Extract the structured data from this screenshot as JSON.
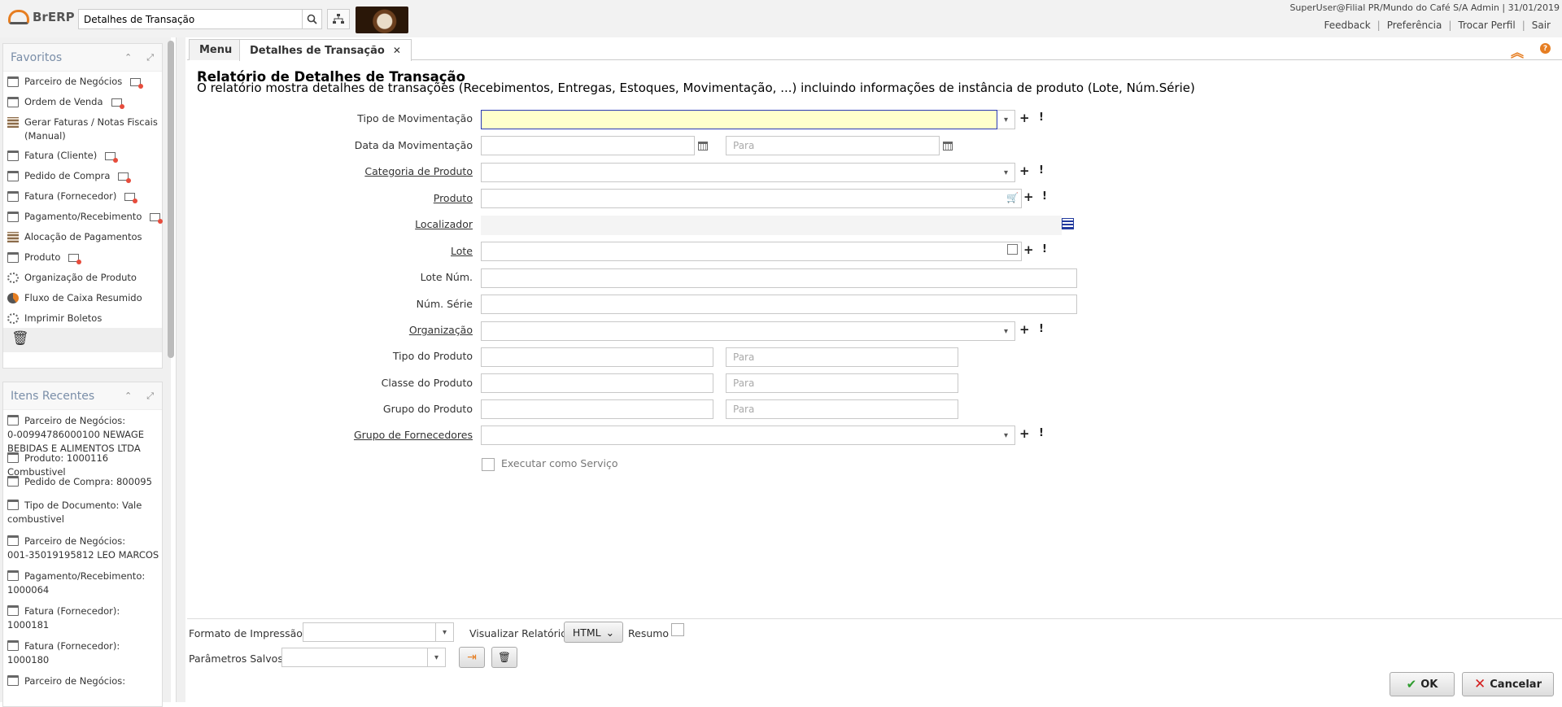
{
  "header": {
    "logo_text": "BrERP",
    "search_value": "Detalhes de Transação",
    "user_info": "SuperUser@Filial PR/Mundo do Café S/A Admin | 31/01/2019",
    "links": [
      "Feedback",
      "Preferência",
      "Trocar Perfil",
      "Sair"
    ]
  },
  "favorites": {
    "title": "Favoritos",
    "items": [
      {
        "label": "Parceiro de Negócios",
        "icon": "window-icon",
        "newwin": true
      },
      {
        "label": "Ordem de Venda",
        "icon": "window-icon",
        "newwin": true
      },
      {
        "label": "Gerar Faturas / Notas Fiscais (Manual)",
        "icon": "grid-icon",
        "newwin": false
      },
      {
        "label": "Fatura (Cliente)",
        "icon": "window-icon",
        "newwin": true
      },
      {
        "label": "Pedido de Compra",
        "icon": "window-icon",
        "newwin": true
      },
      {
        "label": "Fatura (Fornecedor)",
        "icon": "window-icon",
        "newwin": true
      },
      {
        "label": "Pagamento/Recebimento",
        "icon": "window-icon",
        "newwin": true
      },
      {
        "label": "Alocação de Pagamentos",
        "icon": "grid-icon",
        "newwin": false
      },
      {
        "label": "Produto",
        "icon": "window-icon",
        "newwin": true
      },
      {
        "label": "Organização de Produto",
        "icon": "gear-icon",
        "newwin": false
      },
      {
        "label": "Fluxo de Caixa Resumido",
        "icon": "pie-icon",
        "newwin": false
      },
      {
        "label": "Imprimir Boletos",
        "icon": "gear-icon",
        "newwin": false
      }
    ]
  },
  "recent": {
    "title": "Itens Recentes",
    "items": [
      {
        "line1": "Parceiro de Negócios:",
        "line2": "0-00994786000100 NEWAGE",
        "line3": "BEBIDAS E ALIMENTOS LTDA"
      },
      {
        "line1": "Produto: 1000116",
        "line2": "Combustivel",
        "line3": ""
      },
      {
        "line1": "Pedido de Compra: 800095",
        "line2": "",
        "line3": ""
      },
      {
        "line1": "Tipo de Documento: Vale",
        "line2": "combustivel",
        "line3": ""
      },
      {
        "line1": "Parceiro de Negócios:",
        "line2": "001-35019195812 LEO MARCOS",
        "line3": ""
      },
      {
        "line1": "Pagamento/Recebimento:",
        "line2": "1000064",
        "line3": ""
      },
      {
        "line1": "Fatura (Fornecedor):",
        "line2": "1000181",
        "line3": ""
      },
      {
        "line1": "Fatura (Fornecedor):",
        "line2": "1000180",
        "line3": ""
      },
      {
        "line1": "Parceiro de Negócios:",
        "line2": "",
        "line3": ""
      }
    ]
  },
  "tabs": [
    {
      "label": "Menu"
    },
    {
      "label": "Detalhes de Transação"
    }
  ],
  "report": {
    "title": "Relatório de Detalhes de Transação",
    "description": "O relatório mostra detalhes de transações (Recebimentos, Entregas, Estoques, Movimentação, ...) incluindo informações de instância de produto (Lote, Núm.Série)"
  },
  "form": {
    "tipo_mov": "Tipo de Movimentação",
    "data_mov": "Data da Movimentação",
    "categoria": "Categoria de Produto",
    "produto": "Produto",
    "localizador": "Localizador",
    "lote": "Lote",
    "lote_num": "Lote Núm.",
    "num_serie": "Núm. Série",
    "organizacao": "Organização",
    "tipo_produto": "Tipo do Produto",
    "classe_produto": "Classe do Produto",
    "grupo_produto": "Grupo do Produto",
    "grupo_fornecedores": "Grupo de Fornecedores",
    "para": "Para",
    "executar_servico": "Executar como Serviço"
  },
  "bottom": {
    "formato": "Formato de Impressão",
    "visualizar": "Visualizar Relatório",
    "format_value": "HTML",
    "resumo": "Resumo",
    "parametros": "Parâmetros Salvos",
    "ok": "OK",
    "cancelar": "Cancelar"
  }
}
